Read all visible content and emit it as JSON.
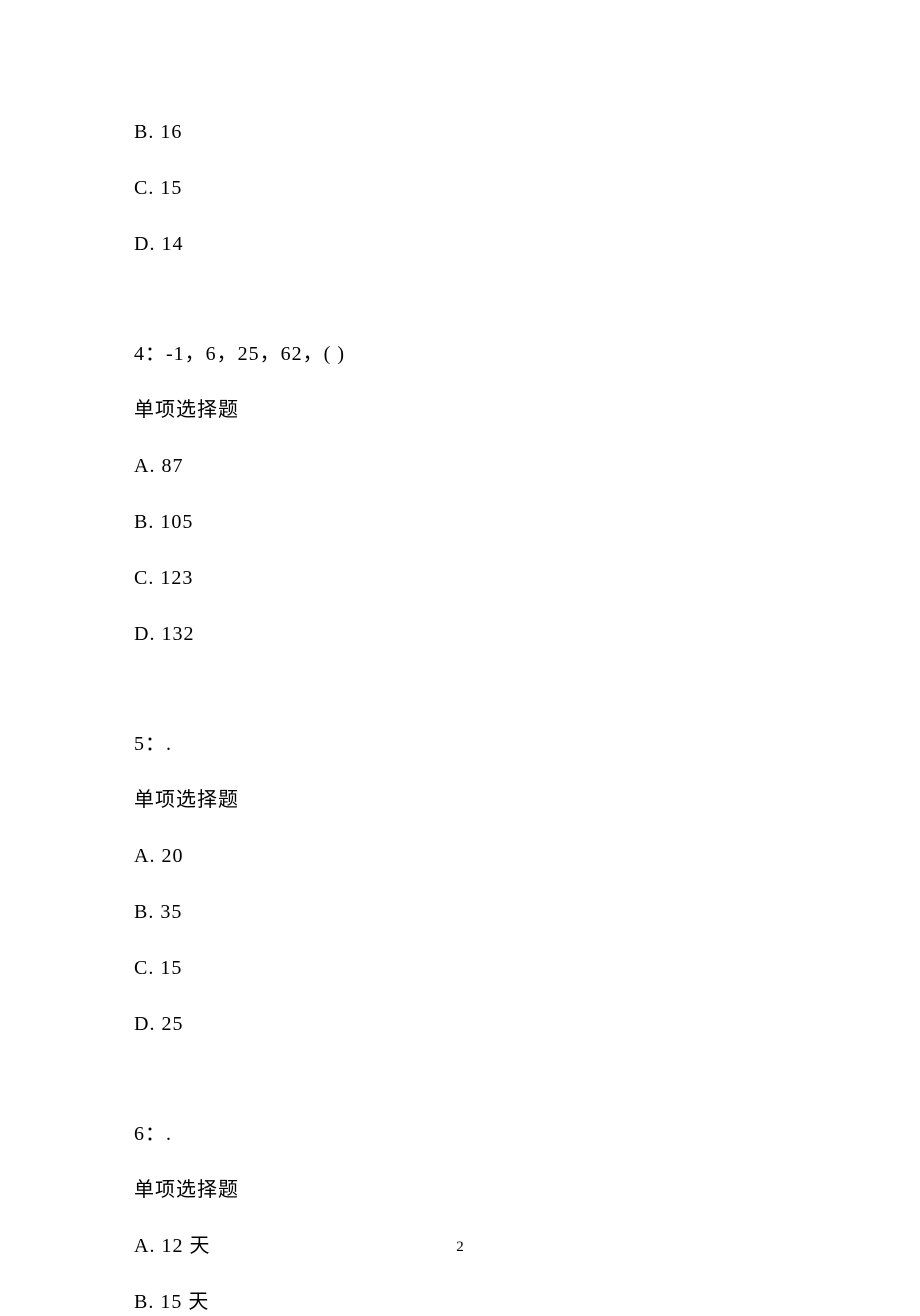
{
  "q3_partial": {
    "optB": "B. 16",
    "optC": "C. 15",
    "optD": "D. 14"
  },
  "q4": {
    "title": "4：-1，6，25，62，( )",
    "subtype": "单项选择题",
    "optA": "A. 87",
    "optB": "B. 105",
    "optC": "C. 123",
    "optD": "D. 132"
  },
  "q5": {
    "title": "5：.",
    "subtype": "单项选择题",
    "optA": "A. 20",
    "optB": "B. 35",
    "optC": "C. 15",
    "optD": "D. 25"
  },
  "q6": {
    "title": "6：.",
    "subtype": "单项选择题",
    "optA": "A. 12 天",
    "optB": "B. 15 天"
  },
  "pageNumber": "2"
}
